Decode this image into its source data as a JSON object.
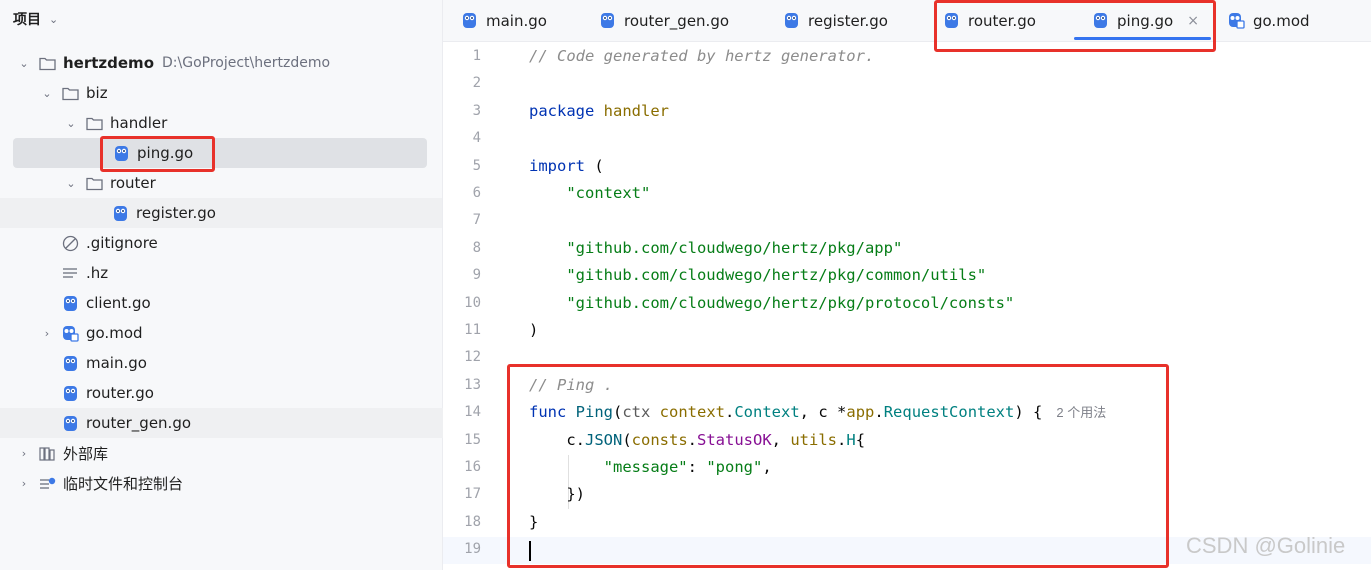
{
  "project_panel": {
    "title": "项目",
    "tree": [
      {
        "label": "hertzdemo",
        "path": "D:\\GoProject\\hertzdemo",
        "icon": "folder-icon",
        "expanded": true
      },
      {
        "label": "biz",
        "icon": "folder-icon",
        "expanded": true
      },
      {
        "label": "handler",
        "icon": "folder-icon",
        "expanded": true
      },
      {
        "label": "ping.go",
        "icon": "go-file-icon",
        "selected": true
      },
      {
        "label": "router",
        "icon": "folder-icon",
        "expanded": true
      },
      {
        "label": "register.go",
        "icon": "go-file-icon"
      },
      {
        "label": ".gitignore",
        "icon": "ignore-file-icon"
      },
      {
        "label": ".hz",
        "icon": "text-file-icon"
      },
      {
        "label": "client.go",
        "icon": "go-file-icon"
      },
      {
        "label": "go.mod",
        "icon": "go-mod-icon",
        "expanded": false
      },
      {
        "label": "main.go",
        "icon": "go-file-icon"
      },
      {
        "label": "router.go",
        "icon": "go-file-icon"
      },
      {
        "label": "router_gen.go",
        "icon": "go-file-icon"
      },
      {
        "label": "外部库",
        "icon": "library-icon",
        "expanded": false
      },
      {
        "label": "临时文件和控制台",
        "icon": "scratches-icon",
        "expanded": false
      }
    ]
  },
  "tabs": [
    {
      "label": "main.go",
      "icon": "go-file-icon"
    },
    {
      "label": "router_gen.go",
      "icon": "go-file-icon"
    },
    {
      "label": "register.go",
      "icon": "go-file-icon"
    },
    {
      "label": "router.go",
      "icon": "go-file-icon"
    },
    {
      "label": "ping.go",
      "icon": "go-file-icon",
      "active": true,
      "close": "×"
    },
    {
      "label": "go.mod",
      "icon": "go-mod-icon"
    }
  ],
  "editor": {
    "line_numbers": [
      "1",
      "2",
      "3",
      "4",
      "5",
      "6",
      "7",
      "8",
      "9",
      "10",
      "11",
      "12",
      "13",
      "14",
      "15",
      "16",
      "17",
      "18",
      "19"
    ],
    "lines": [
      [
        {
          "t": "// Code generated by hertz generator.",
          "c": "cm"
        }
      ],
      [],
      [
        {
          "t": "package ",
          "c": "kw"
        },
        {
          "t": "handler",
          "c": "pkg"
        }
      ],
      [],
      [
        {
          "t": "import ",
          "c": "kw"
        },
        {
          "t": "(",
          "c": ""
        }
      ],
      [
        {
          "t": "    ",
          "c": ""
        },
        {
          "t": "\"context\"",
          "c": "str"
        }
      ],
      [],
      [
        {
          "t": "    ",
          "c": ""
        },
        {
          "t": "\"github.com/cloudwego/hertz/pkg/app\"",
          "c": "str"
        }
      ],
      [
        {
          "t": "    ",
          "c": ""
        },
        {
          "t": "\"github.com/cloudwego/hertz/pkg/common/utils\"",
          "c": "str"
        }
      ],
      [
        {
          "t": "    ",
          "c": ""
        },
        {
          "t": "\"github.com/cloudwego/hertz/pkg/protocol/consts\"",
          "c": "str"
        }
      ],
      [
        {
          "t": ")",
          "c": ""
        }
      ],
      [],
      [
        {
          "t": "// Ping .",
          "c": "cm"
        }
      ],
      [
        {
          "t": "func ",
          "c": "kw"
        },
        {
          "t": "Ping",
          "c": "fn"
        },
        {
          "t": "(",
          "c": ""
        },
        {
          "t": "ctx ",
          "c": "par"
        },
        {
          "t": "context",
          "c": "pkg"
        },
        {
          "t": ".",
          "c": ""
        },
        {
          "t": "Context",
          "c": "ty"
        },
        {
          "t": ", ",
          "c": ""
        },
        {
          "t": "c ",
          "c": ""
        },
        {
          "t": "*",
          "c": ""
        },
        {
          "t": "app",
          "c": "pkg"
        },
        {
          "t": ".",
          "c": ""
        },
        {
          "t": "RequestContext",
          "c": "ty"
        },
        {
          "t": ") {",
          "c": ""
        }
      ],
      [
        {
          "t": "    c.",
          "c": ""
        },
        {
          "t": "JSON",
          "c": "fn"
        },
        {
          "t": "(",
          "c": ""
        },
        {
          "t": "consts",
          "c": "pkg"
        },
        {
          "t": ".",
          "c": ""
        },
        {
          "t": "StatusOK",
          "c": "ns"
        },
        {
          "t": ", ",
          "c": ""
        },
        {
          "t": "utils",
          "c": "pkg"
        },
        {
          "t": ".",
          "c": ""
        },
        {
          "t": "H",
          "c": "ty"
        },
        {
          "t": "{",
          "c": ""
        }
      ],
      [
        {
          "t": "        ",
          "c": ""
        },
        {
          "t": "\"message\"",
          "c": "str"
        },
        {
          "t": ": ",
          "c": ""
        },
        {
          "t": "\"pong\"",
          "c": "str"
        },
        {
          "t": ",",
          "c": ""
        }
      ],
      [
        {
          "t": "    })",
          "c": ""
        }
      ],
      [
        {
          "t": "}",
          "c": ""
        }
      ],
      []
    ],
    "usages_hint": "2 个用法"
  },
  "watermark": "CSDN @Golinie",
  "colors": {
    "annotation": "#e8312a",
    "accent": "#3574f0"
  }
}
